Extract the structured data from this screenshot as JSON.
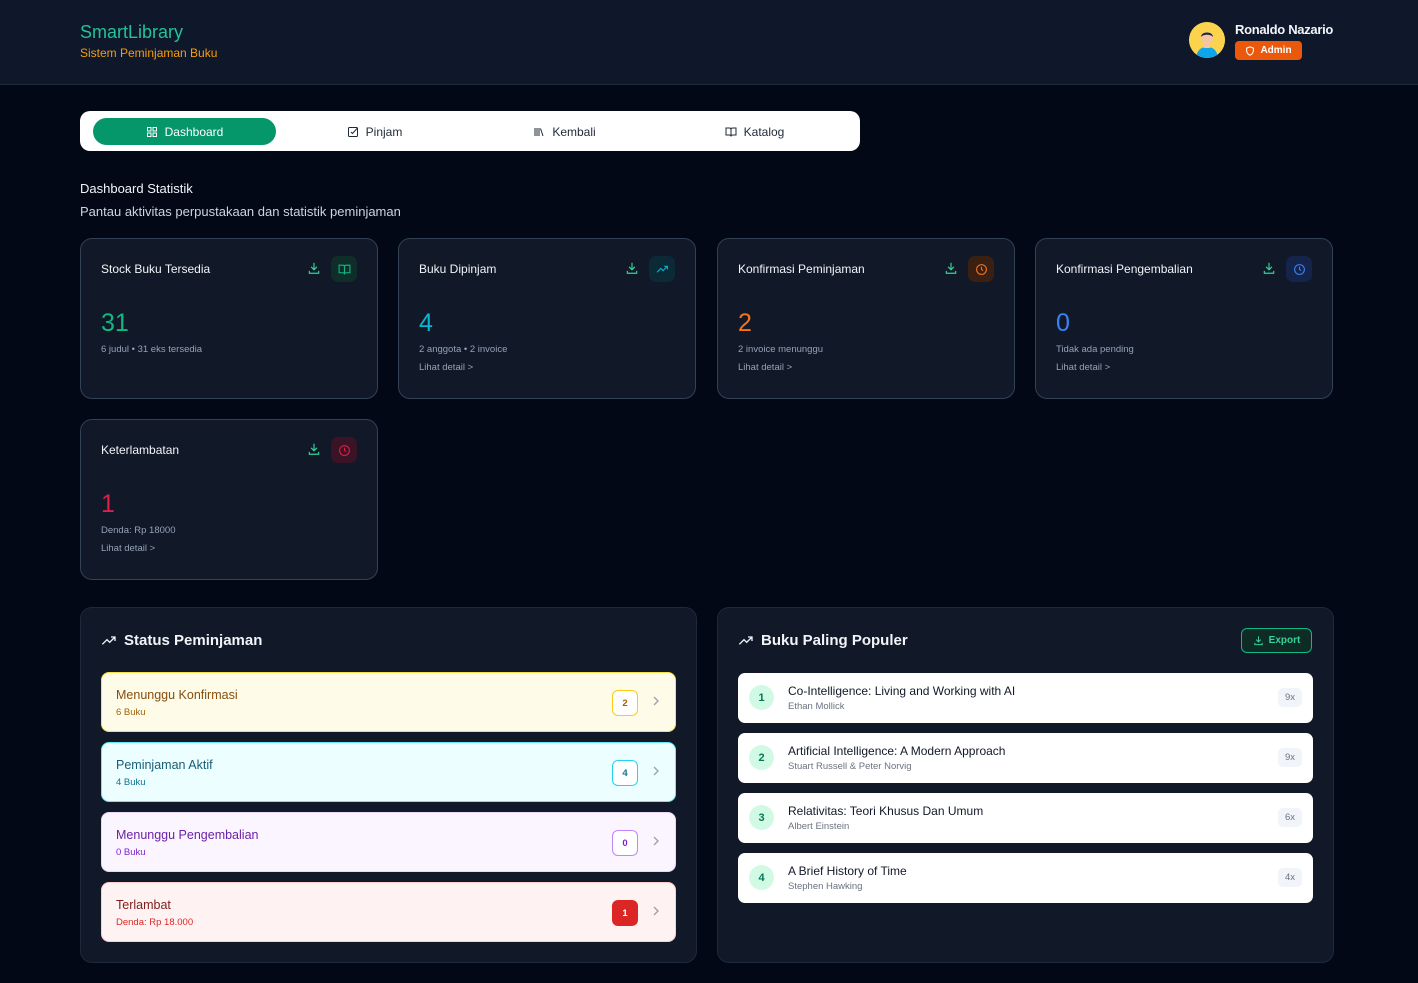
{
  "app": {
    "name": "SmartLibrary",
    "subtitle": "Sistem Peminjaman Buku"
  },
  "user": {
    "name": "Ronaldo Nazario",
    "role": "Admin"
  },
  "tabs": [
    {
      "label": "Dashboard",
      "icon": "grid-icon",
      "active": true
    },
    {
      "label": "Pinjam",
      "icon": "checkbox-icon",
      "active": false
    },
    {
      "label": "Kembali",
      "icon": "library-icon",
      "active": false
    },
    {
      "label": "Katalog",
      "icon": "book-open-icon",
      "active": false
    }
  ],
  "section": {
    "title": "Dashboard Statistik",
    "subtitle": "Pantau aktivitas perpustakaan dan statistik peminjaman"
  },
  "stats": [
    {
      "title": "Stock Buku Tersedia",
      "value": "31",
      "info": "6 judul • 31 eks tersedia",
      "link": "",
      "color": "#10b981",
      "icon": "book-open-icon"
    },
    {
      "title": "Buku Dipinjam",
      "value": "4",
      "info": "2 anggota • 2 invoice",
      "link": "Lihat detail >",
      "color": "#06b6d4",
      "icon": "trending-up-icon"
    },
    {
      "title": "Konfirmasi Peminjaman",
      "value": "2",
      "info": "2 invoice menunggu",
      "link": "Lihat detail >",
      "color": "#f97316",
      "icon": "clock-icon"
    },
    {
      "title": "Konfirmasi Pengembalian",
      "value": "0",
      "info": "Tidak ada pending",
      "link": "Lihat detail >",
      "color": "#3b82f6",
      "icon": "clock-icon"
    },
    {
      "title": "Keterlambatan",
      "value": "1",
      "info": "Denda: Rp 18000",
      "link": "Lihat detail >",
      "color": "#e11d48",
      "icon": "alarm-icon"
    }
  ],
  "status_panel": {
    "title": "Status Peminjaman",
    "items": [
      {
        "label": "Menunggu Konfirmasi",
        "sub": "6 Buku",
        "count": "2",
        "bg": "#fefce8",
        "border": "#fde047",
        "text": "#854d0e",
        "sub_color": "#a16207",
        "count_color": "#a16207",
        "count_border": "#facc15",
        "count_bg": "#ffffff"
      },
      {
        "label": "Peminjaman Aktif",
        "sub": "4 Buku",
        "count": "4",
        "bg": "#ecfeff",
        "border": "#67e8f9",
        "text": "#155e75",
        "sub_color": "#0e7490",
        "count_color": "#0e7490",
        "count_border": "#22d3ee",
        "count_bg": "#ffffff"
      },
      {
        "label": "Menunggu Pengembalian",
        "sub": "0 Buku",
        "count": "0",
        "bg": "#faf5ff",
        "border": "#e9d5ff",
        "text": "#6b21a8",
        "sub_color": "#7e22ce",
        "count_color": "#7e22ce",
        "count_border": "#c084fc",
        "count_bg": "#ffffff"
      },
      {
        "label": "Terlambat",
        "sub": "Denda: Rp 18.000",
        "count": "1",
        "bg": "#fef2f2",
        "border": "#fecaca",
        "text": "#7f1d1d",
        "sub_color": "#dc2626",
        "count_color": "#ffffff",
        "count_border": "#dc2626",
        "count_bg": "#dc2626"
      }
    ]
  },
  "popular_panel": {
    "title": "Buku Paling Populer",
    "export_label": "Export",
    "books": [
      {
        "rank": "1",
        "title": "Co-Intelligence: Living and Working with AI",
        "author": "Ethan Mollick",
        "count": "9x"
      },
      {
        "rank": "2",
        "title": "Artificial Intelligence: A Modern Approach",
        "author": "Stuart Russell & Peter Norvig",
        "count": "9x"
      },
      {
        "rank": "3",
        "title": "Relativitas: Teori Khusus Dan Umum",
        "author": "Albert Einstein",
        "count": "6x"
      },
      {
        "rank": "4",
        "title": "A Brief History of Time",
        "author": "Stephen Hawking",
        "count": "4x"
      }
    ]
  }
}
